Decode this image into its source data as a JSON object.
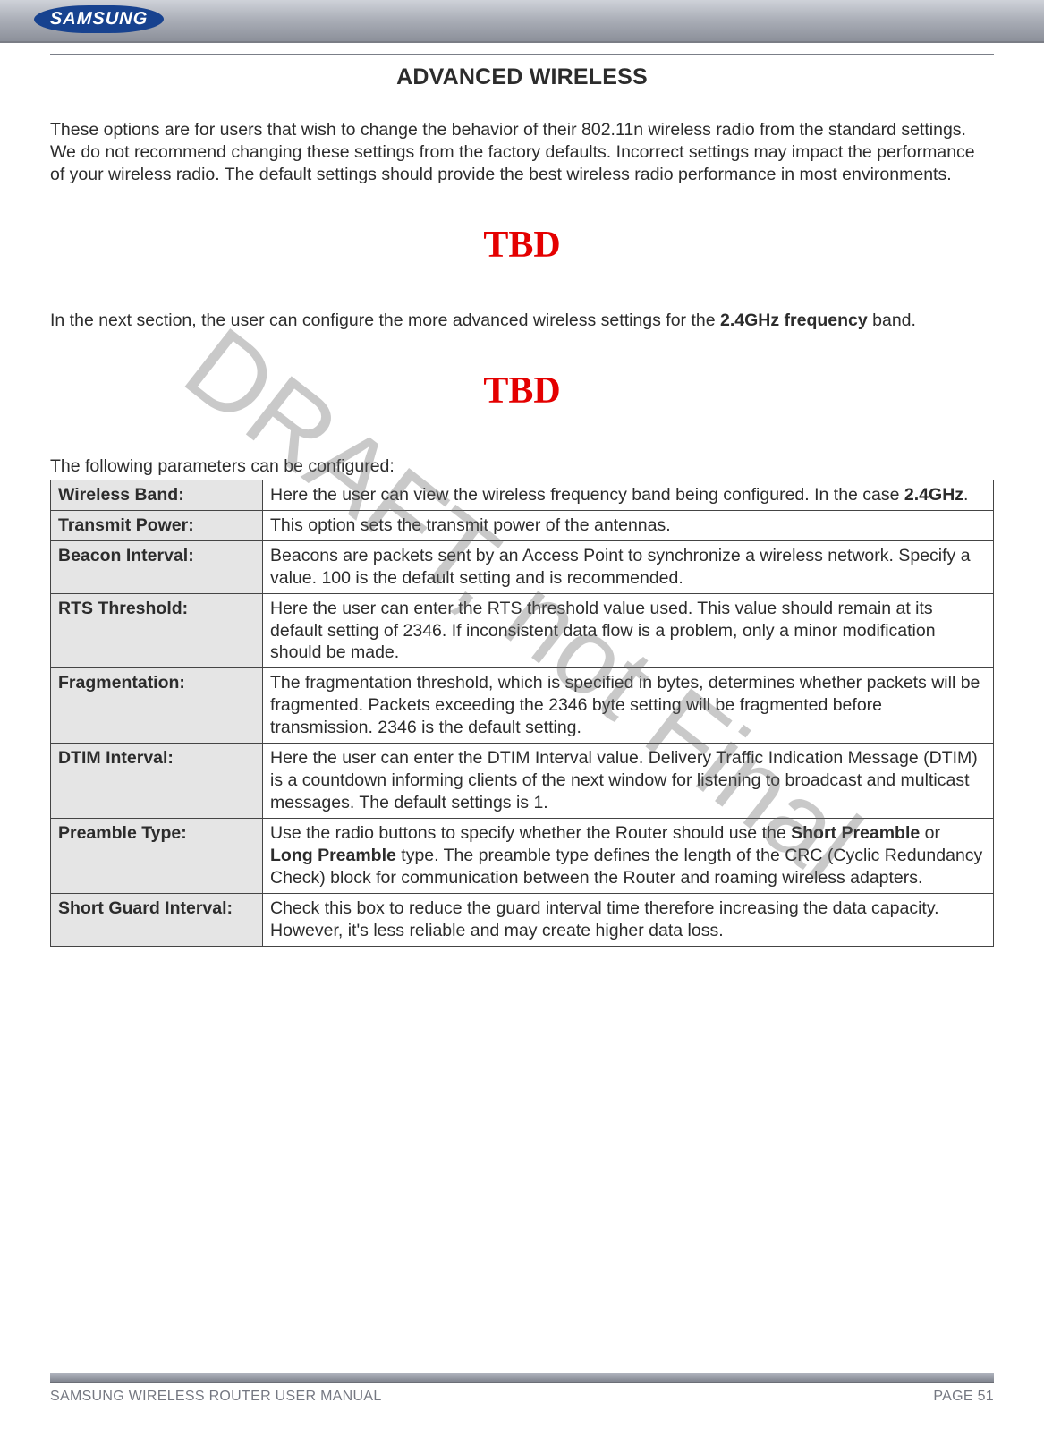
{
  "brand": "SAMSUNG",
  "heading": "ADVANCED WIRELESS",
  "watermark": "DRAFT, not Final",
  "intro": "These options are for users that wish to change the behavior of their 802.11n wireless radio from the standard settings. We do not recommend changing these settings from the factory defaults. Incorrect settings may impact the performance of your wireless radio. The default settings should provide the best wireless radio performance in most environments.",
  "tbd1": "TBD",
  "next_section_pre": "In the next section, the user can configure the more advanced wireless settings for the ",
  "next_section_bold": "2.4GHz frequency",
  "next_section_post": " band.",
  "tbd2": "TBD",
  "params_intro": "The following parameters can be configured:",
  "table": {
    "rows": [
      {
        "label": "Wireless Band:",
        "desc_pre": "Here the user can view the wireless frequency band being configured. In the case ",
        "desc_bold": "2.4GHz",
        "desc_post": "."
      },
      {
        "label": "Transmit Power:",
        "desc": "This option sets the transmit power of the antennas."
      },
      {
        "label": "Beacon Interval:",
        "desc": "Beacons are packets sent by an Access Point to synchronize a wireless network. Specify a value. 100 is the default setting and is recommended."
      },
      {
        "label": "RTS Threshold:",
        "desc": "Here the user can enter the RTS threshold value used. This value should remain at its default setting of 2346. If inconsistent data flow is a problem, only a minor modification should be made."
      },
      {
        "label": "Fragmentation:",
        "desc": "The fragmentation threshold, which is specified in bytes, determines whether packets will be fragmented. Packets exceeding the 2346 byte setting will be fragmented before transmission. 2346 is the default setting."
      },
      {
        "label": "DTIM Interval:",
        "desc": "Here the user can enter the DTIM Interval value. Delivery Traffic Indication Message (DTIM) is a countdown informing clients of the next window for listening to broadcast and multicast messages. The default settings is 1."
      },
      {
        "label": "Preamble Type:",
        "desc_pre": "Use the radio buttons to specify whether the Router should use the ",
        "desc_bold": "Short Preamble",
        "desc_mid": " or ",
        "desc_bold2": "Long Preamble",
        "desc_post": " type. The preamble type defines the length of the CRC (Cyclic Redundancy Check) block for communication between the Router and roaming wireless adapters."
      },
      {
        "label": "Short Guard Interval:",
        "desc": "Check this box to reduce the guard interval time therefore increasing the data capacity. However, it's less reliable and may create higher data loss."
      }
    ]
  },
  "footer": {
    "left": "SAMSUNG WIRELESS ROUTER USER MANUAL",
    "right_label": "PAGE ",
    "right_num": "51"
  }
}
